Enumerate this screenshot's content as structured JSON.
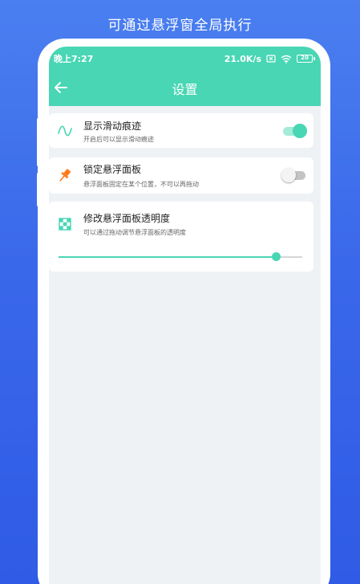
{
  "headline": "可通过悬浮窗全局执行",
  "status_bar": {
    "time": "晚上7:27",
    "network_speed": "21.0K/s",
    "battery_level": "20",
    "icons": [
      "sim-off-icon",
      "wifi-icon",
      "battery-icon"
    ]
  },
  "app_bar": {
    "back_icon": "arrow-left-icon",
    "title": "设置"
  },
  "settings": [
    {
      "icon": "wave-icon",
      "label": "显示滑动痕迹",
      "description": "开启后可以显示滑动痕迹",
      "control": "switch",
      "enabled": true
    },
    {
      "icon": "pin-icon",
      "label": "锁定悬浮面板",
      "description": "悬浮面板固定在某个位置，不可以再拖动",
      "control": "switch",
      "enabled": false
    },
    {
      "icon": "checkerboard-icon",
      "label": "修改悬浮面板透明度",
      "description": "可以通过拖动调节悬浮面板的透明度",
      "control": "slider",
      "value_fraction": 0.89
    }
  ],
  "colors": {
    "background": "#3a68ea",
    "accent": "#48d6b4",
    "screen_background": "#eff2f5",
    "pin_icon": "#ff7b1a"
  }
}
